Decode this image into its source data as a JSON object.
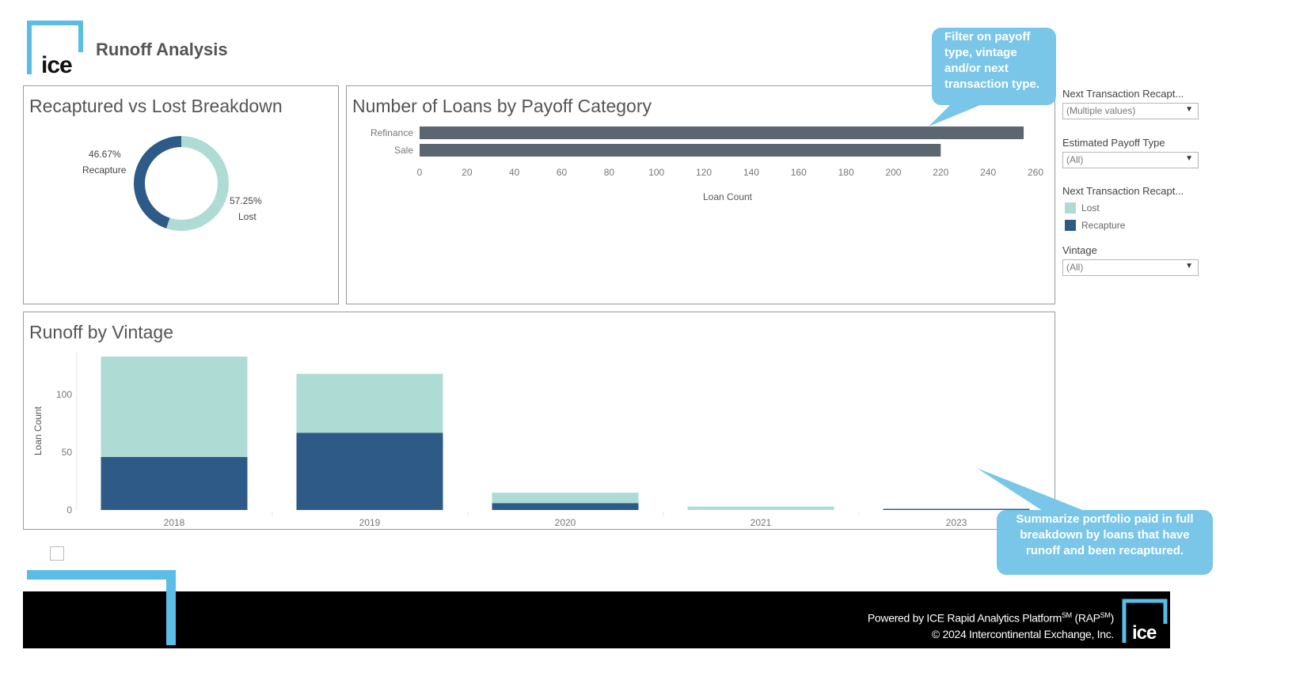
{
  "header": {
    "title": "Runoff Analysis",
    "logo_text": "ice"
  },
  "panels": {
    "breakdown": {
      "title": "Recaptured vs Lost Breakdown",
      "recapture_pct": "46.67%",
      "recapture_label": "Recapture",
      "lost_pct": "57.25%",
      "lost_label": "Lost"
    },
    "payoff": {
      "title": "Number of Loans by Payoff Category"
    },
    "vintage": {
      "title": "Runoff by Vintage"
    }
  },
  "filters": {
    "next_txn_filter_label": "Next Transaction Recapt...",
    "next_txn_filter_value": "(Multiple values)",
    "payoff_type_label": "Estimated Payoff Type",
    "payoff_type_value": "(All)",
    "legend_label": "Next Transaction Recapt...",
    "legend_items": [
      {
        "label": "Lost",
        "color": "#aedcd4"
      },
      {
        "label": "Recapture",
        "color": "#2d5a87"
      }
    ],
    "vintage_label": "Vintage",
    "vintage_value": "(All)"
  },
  "callouts": {
    "top": "Filter on payoff type, vintage and/or next transaction type.",
    "bottom": "Summarize portfolio paid in full breakdown by loans that have runoff and been recaptured."
  },
  "footer": {
    "line1_prefix": "Powered by ICE Rapid Analytics Platform",
    "sm": "SM",
    "line1_mid": " (RAP",
    "line1_suffix": ")",
    "line2": "© 2024 Intercontinental Exchange, Inc.",
    "logo_text": "ice"
  },
  "colors": {
    "lost": "#aedcd4",
    "recapture": "#2d5a87",
    "bar": "#5b6670",
    "accent": "#5bbde6"
  },
  "chart_data": [
    {
      "type": "pie",
      "labels": [
        "Recapture",
        "Lost"
      ],
      "values": [
        46.67,
        57.25
      ]
    },
    {
      "type": "bar",
      "orientation": "horizontal",
      "categories": [
        "Refinance",
        "Sale"
      ],
      "values": [
        255,
        220
      ],
      "xlabel": "Loan Count",
      "xlim": [
        0,
        260
      ],
      "xticks": [
        0,
        20,
        40,
        60,
        80,
        100,
        120,
        140,
        160,
        180,
        200,
        220,
        240,
        260
      ]
    },
    {
      "type": "bar",
      "stacked": true,
      "categories": [
        "2018",
        "2019",
        "2020",
        "2021",
        "2023"
      ],
      "series": [
        {
          "name": "Recapture",
          "values": [
            46,
            67,
            6,
            0,
            1
          ]
        },
        {
          "name": "Lost",
          "values": [
            87,
            51,
            9,
            3,
            0
          ]
        }
      ],
      "ylabel": "Loan Count",
      "ylim": [
        0,
        133
      ],
      "yticks": [
        0,
        50,
        100
      ]
    }
  ]
}
